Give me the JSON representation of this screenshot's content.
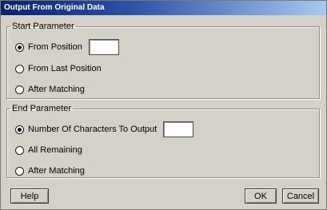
{
  "window": {
    "title": "Output From Original Data"
  },
  "start_parameter": {
    "legend": "Start Parameter",
    "options": [
      {
        "label": "From Position",
        "checked": true,
        "has_field": true,
        "field_value": ""
      },
      {
        "label": "From Last Position",
        "checked": false
      },
      {
        "label": "After Matching",
        "checked": false
      }
    ]
  },
  "end_parameter": {
    "legend": "End Parameter",
    "options": [
      {
        "label": "Number Of Characters To Output",
        "checked": true,
        "has_field": true,
        "field_value": ""
      },
      {
        "label": "All Remaining",
        "checked": false
      },
      {
        "label": "After Matching",
        "checked": false
      }
    ]
  },
  "buttons": {
    "help": "Help",
    "ok": "OK",
    "cancel": "Cancel"
  },
  "colors": {
    "dialog_bg": "#d4d2c8",
    "title_bar": "#0a246a",
    "title_text": "#ffffff"
  }
}
